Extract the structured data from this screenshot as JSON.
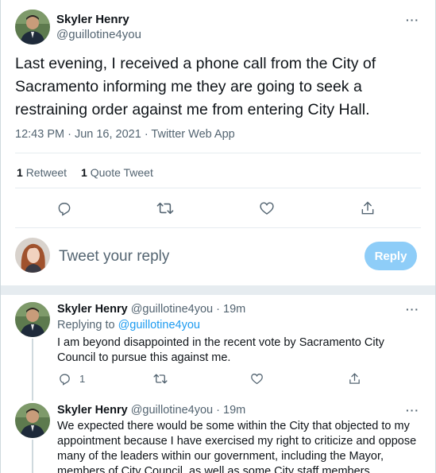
{
  "main_tweet": {
    "name": "Skyler Henry",
    "handle": "@guillotine4you",
    "text": "Last evening, I received a phone call from the City of Sacramento informing me they are going to seek a restraining order against me from entering City Hall.",
    "meta": "12:43 PM · Jun 16, 2021 · Twitter Web App",
    "retweet_count": "1",
    "retweet_label": "Retweet",
    "quote_count": "1",
    "quote_label": "Quote Tweet",
    "more": "···"
  },
  "reply_box": {
    "placeholder": "Tweet your reply",
    "button": "Reply"
  },
  "replies": [
    {
      "name": "Skyler Henry",
      "handle": "@guillotine4you",
      "time": "19m",
      "replying_prefix": "Replying to",
      "replying_to": "@guillotine4you",
      "text": "I am beyond disappointed in the recent vote by Sacramento City Council to pursue this against me.",
      "reply_count": "1",
      "more": "···"
    },
    {
      "name": "Skyler Henry",
      "handle": "@guillotine4you",
      "time": "19m",
      "text": "We expected there would be some within the City that objected to my appointment because I have exercised my right to criticize and oppose many of the leaders within our government, including the Mayor, members of City Council, as well as some City staff members.",
      "more": "···"
    }
  ],
  "colors": {
    "accent": "#1d9bf0",
    "reply_button": "#8ecdf8",
    "muted": "#536471",
    "divider": "#e6ecf0"
  },
  "icons": [
    "reply-icon",
    "retweet-icon",
    "like-icon",
    "share-icon",
    "more-icon"
  ]
}
